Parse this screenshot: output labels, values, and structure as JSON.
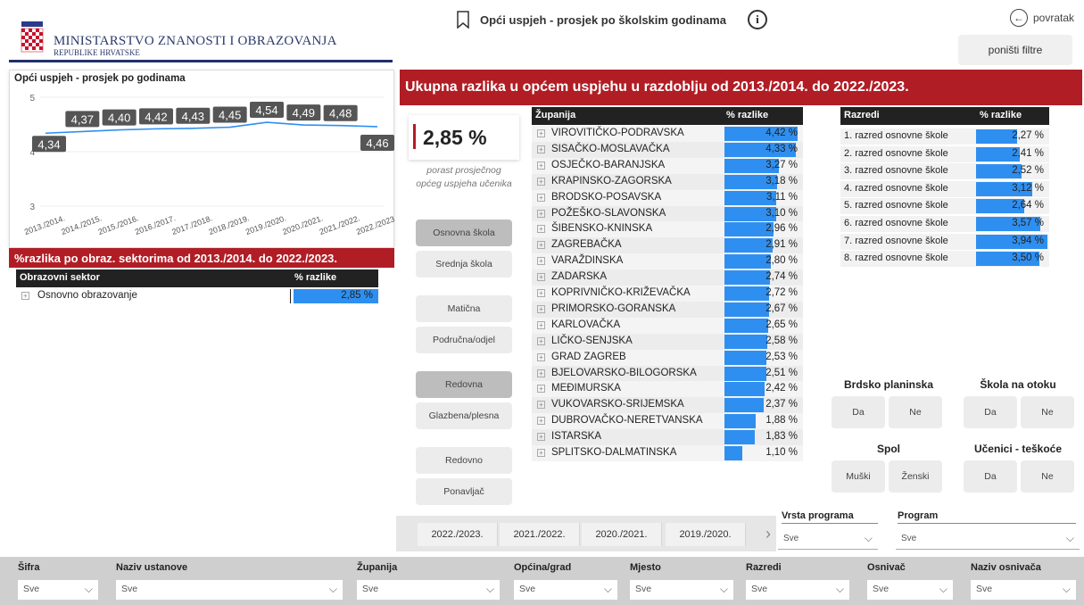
{
  "header": {
    "ministry_name": "MINISTARSTVO ZNANOSTI I OBRAZOVANJA",
    "ministry_sub": "REPUBLIKE HRVATSKE",
    "page_title": "Opći uspjeh - prosjek po školskim godinama",
    "info_label": "i",
    "back_label": "povratak",
    "reset_label": "poništi filtre"
  },
  "line_chart": {
    "title": "Opći uspjeh - prosjek po godinama",
    "chart_data": {
      "type": "line",
      "title": "Opći uspjeh - prosjek po godinama",
      "categories": [
        "2013./2014.",
        "2014./2015.",
        "2015./2016.",
        "2016./2017.",
        "2017./2018.",
        "2018./2019.",
        "2019./2020.",
        "2020./2021.",
        "2021./2022.",
        "2022./2023."
      ],
      "values": [
        4.34,
        4.37,
        4.4,
        4.42,
        4.43,
        4.45,
        4.54,
        4.49,
        4.48,
        4.46
      ],
      "data_labels": [
        "4,34",
        "4,37",
        "4,40",
        "4,42",
        "4,43",
        "4,45",
        "4,54",
        "4,49",
        "4,48",
        "4,46"
      ],
      "yticks": [
        "3",
        "4",
        "5"
      ],
      "ylim": [
        3,
        5
      ],
      "color": "#2f8ff0"
    }
  },
  "sector": {
    "banner": "%razlika po obraz. sektorima od 2013./2014. do 2022./2023.",
    "col1": "Obrazovni sektor",
    "col2": "% razlike",
    "rows": [
      {
        "name": "Osnovno obrazovanje",
        "value": "2,85 %",
        "pct": 2.85
      }
    ]
  },
  "main_banner": "Ukupna razlika u općem uspjehu u razdoblju od 2013./2014. do 2022./2023.",
  "kpi": {
    "value": "2,85 %",
    "caption_line1": "porast prosječnog",
    "caption_line2": "općeg uspjeha učenika"
  },
  "slicers": {
    "school_type": [
      "Osnovna škola",
      "Srednja škola"
    ],
    "school_kind": [
      "Matična",
      "Područna/odjel"
    ],
    "program_kind": [
      "Redovna",
      "Glazbena/plesna"
    ],
    "student_kind": [
      "Redovno",
      "Ponavljač"
    ]
  },
  "counties": {
    "col1": "Županija",
    "col2": "% razlike",
    "rows": [
      {
        "name": "VIROVITIČKO-PODRAVSKA",
        "value": "4,42 %",
        "pct": 4.42
      },
      {
        "name": "SISAČKO-MOSLAVAČKA",
        "value": "4,33 %",
        "pct": 4.33
      },
      {
        "name": "OSJEČKO-BARANJSKA",
        "value": "3,27 %",
        "pct": 3.27
      },
      {
        "name": "KRAPINSKO-ZAGORSKA",
        "value": "3,18 %",
        "pct": 3.18
      },
      {
        "name": "BRODSKO-POSAVSKA",
        "value": "3,11 %",
        "pct": 3.11
      },
      {
        "name": "POŽEŠKO-SLAVONSKA",
        "value": "3,10 %",
        "pct": 3.1
      },
      {
        "name": "ŠIBENSKO-KNINSKA",
        "value": "2,96 %",
        "pct": 2.96
      },
      {
        "name": "ZAGREBAČKA",
        "value": "2,91 %",
        "pct": 2.91
      },
      {
        "name": "VARAŽDINSKA",
        "value": "2,80 %",
        "pct": 2.8
      },
      {
        "name": "ZADARSKA",
        "value": "2,74 %",
        "pct": 2.74
      },
      {
        "name": "KOPRIVNIČKO-KRIŽEVAČKA",
        "value": "2,72 %",
        "pct": 2.72
      },
      {
        "name": "PRIMORSKO-GORANSKA",
        "value": "2,67 %",
        "pct": 2.67
      },
      {
        "name": "KARLOVAČKA",
        "value": "2,65 %",
        "pct": 2.65
      },
      {
        "name": "LIČKO-SENJSKA",
        "value": "2,58 %",
        "pct": 2.58
      },
      {
        "name": "GRAD ZAGREB",
        "value": "2,53 %",
        "pct": 2.53
      },
      {
        "name": "BJELOVARSKO-BILOGORSKA",
        "value": "2,51 %",
        "pct": 2.51
      },
      {
        "name": "MEĐIMURSKA",
        "value": "2,42 %",
        "pct": 2.42
      },
      {
        "name": "VUKOVARSKO-SRIJEMSKA",
        "value": "2,37 %",
        "pct": 2.37
      },
      {
        "name": "DUBROVAČKO-NERETVANSKA",
        "value": "1,88 %",
        "pct": 1.88
      },
      {
        "name": "ISTARSKA",
        "value": "1,83 %",
        "pct": 1.83
      },
      {
        "name": "SPLITSKO-DALMATINSKA",
        "value": "1,10 %",
        "pct": 1.1
      }
    ]
  },
  "grades": {
    "col1": "Razredi",
    "col2": "% razlike",
    "rows": [
      {
        "name": "1. razred osnovne škole",
        "value": "2,27 %",
        "pct": 2.27
      },
      {
        "name": "2. razred osnovne škole",
        "value": "2,41 %",
        "pct": 2.41
      },
      {
        "name": "3. razred osnovne škole",
        "value": "2,52 %",
        "pct": 2.52
      },
      {
        "name": "4. razred osnovne škole",
        "value": "3,12 %",
        "pct": 3.12
      },
      {
        "name": "5. razred osnovne škole",
        "value": "2,64 %",
        "pct": 2.64
      },
      {
        "name": "6. razred osnovne škole",
        "value": "3,57 %",
        "pct": 3.57
      },
      {
        "name": "7. razred osnovne škole",
        "value": "3,94 %",
        "pct": 3.94
      },
      {
        "name": "8. razred osnovne škole",
        "value": "3,50 %",
        "pct": 3.5
      }
    ]
  },
  "toggles": {
    "mountain": {
      "title": "Brdsko planinska",
      "yes": "Da",
      "no": "Ne"
    },
    "island": {
      "title": "Škola na otoku",
      "yes": "Da",
      "no": "Ne"
    },
    "gender": {
      "title": "Spol",
      "male": "Muški",
      "female": "Ženski"
    },
    "difficulty": {
      "title": "Učenici - teškoće",
      "yes": "Da",
      "no": "Ne"
    }
  },
  "years": [
    "2022./2023.",
    "2021./2022.",
    "2020./2021.",
    "2019./2020."
  ],
  "program_filters": {
    "vrsta_label": "Vrsta programa",
    "vrsta_value": "Sve",
    "program_label": "Program",
    "program_value": "Sve"
  },
  "bottom_filters": [
    {
      "label": "Šifra",
      "value": "Sve"
    },
    {
      "label": "Naziv ustanove",
      "value": "Sve"
    },
    {
      "label": "Županija",
      "value": "Sve"
    },
    {
      "label": "Općina/grad",
      "value": "Sve"
    },
    {
      "label": "Mjesto",
      "value": "Sve"
    },
    {
      "label": "Razredi",
      "value": "Sve"
    },
    {
      "label": "Osnivač",
      "value": "Sve"
    },
    {
      "label": "Naziv osnivača",
      "value": "Sve"
    }
  ]
}
